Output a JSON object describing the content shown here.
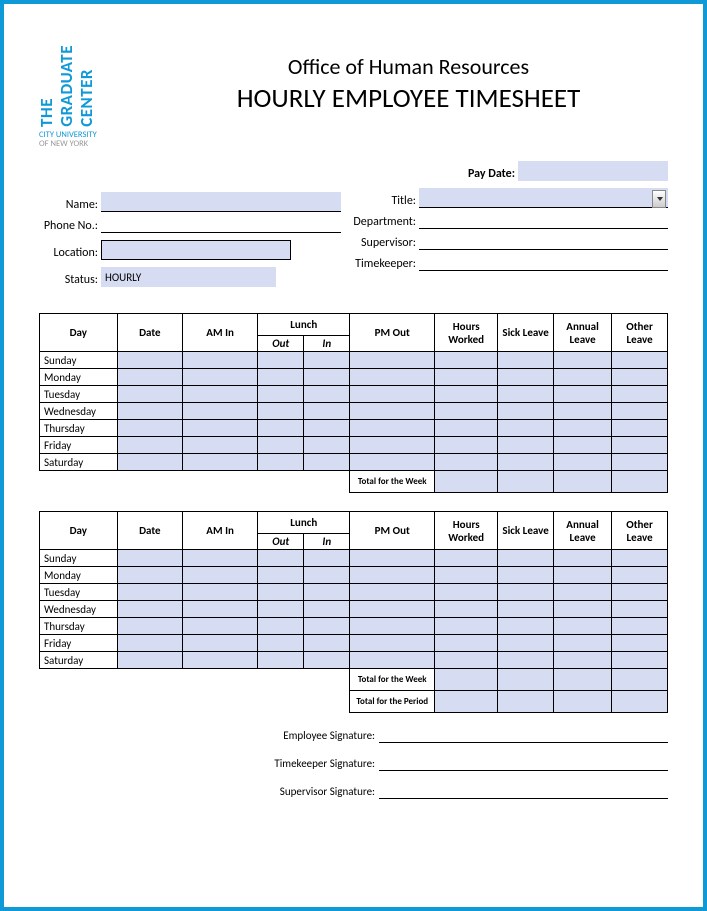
{
  "logo": {
    "line1": "THE",
    "line2": "GRADUATE",
    "line3": "CENTER",
    "sub1": "CITY UNIVERSITY",
    "sub2": "OF NEW YORK"
  },
  "headings": {
    "office": "Office of Human Resources",
    "title": "HOURLY EMPLOYEE TIMESHEET"
  },
  "labels": {
    "paydate": "Pay Date:",
    "name": "Name:",
    "title": "Title:",
    "phone": "Phone No.:",
    "department": "Department:",
    "location": "Location:",
    "supervisor": "Supervisor:",
    "status": "Status:",
    "timekeeper": "Timekeeper:"
  },
  "values": {
    "status": "HOURLY"
  },
  "cols": {
    "day": "Day",
    "date": "Date",
    "amin": "AM In",
    "lunch": "Lunch",
    "out": "Out",
    "in": "In",
    "pmout": "PM Out",
    "hours": "Hours Worked",
    "sick": "Sick Leave",
    "annual": "Annual Leave",
    "other": "Other Leave"
  },
  "days": [
    "Sunday",
    "Monday",
    "Tuesday",
    "Wednesday",
    "Thursday",
    "Friday",
    "Saturday"
  ],
  "totals": {
    "week": "Total for the Week",
    "period": "Total for the Period"
  },
  "sig": {
    "emp": "Employee Signature:",
    "tk": "Timekeeper Signature:",
    "sup": "Supervisor Signature:"
  }
}
